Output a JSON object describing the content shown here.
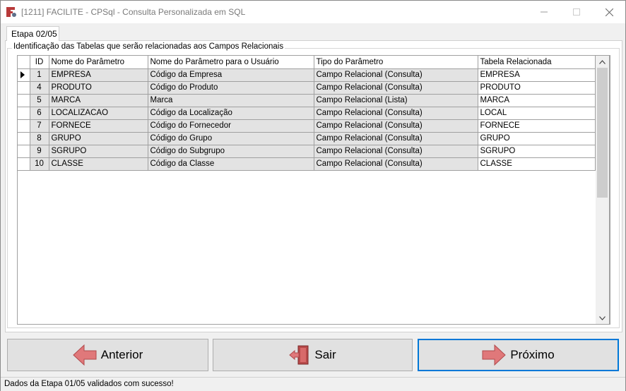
{
  "window": {
    "title": "[1211] FACILITE - CPSql - Consulta Personalizada em SQL",
    "icon": "facilite-app-icon",
    "controls": [
      "minimize",
      "maximize",
      "close"
    ]
  },
  "tab": {
    "label": "Etapa 02/05"
  },
  "group": {
    "legend": "Identificação das Tabelas que serão relacionadas aos Campos Relacionais"
  },
  "grid": {
    "columns": [
      "ID",
      "Nome do Parâmetro",
      "Nome do Parâmetro para o Usuário",
      "Tipo do Parâmetro",
      "Tabela Relacionada"
    ],
    "rows": [
      {
        "id": "1",
        "nome": "EMPRESA",
        "nome_usuario": "Código da Empresa",
        "tipo": "Campo Relacional (Consulta)",
        "tabela": "EMPRESA"
      },
      {
        "id": "4",
        "nome": "PRODUTO",
        "nome_usuario": "Código do Produto",
        "tipo": "Campo Relacional (Consulta)",
        "tabela": "PRODUTO"
      },
      {
        "id": "5",
        "nome": "MARCA",
        "nome_usuario": "Marca",
        "tipo": "Campo Relacional (Lista)",
        "tabela": "MARCA"
      },
      {
        "id": "6",
        "nome": "LOCALIZACAO",
        "nome_usuario": "Código da Localização",
        "tipo": "Campo Relacional (Consulta)",
        "tabela": "LOCAL"
      },
      {
        "id": "7",
        "nome": "FORNECE",
        "nome_usuario": "Código do Fornecedor",
        "tipo": "Campo Relacional (Consulta)",
        "tabela": "FORNECE"
      },
      {
        "id": "8",
        "nome": "GRUPO",
        "nome_usuario": "Código do Grupo",
        "tipo": "Campo Relacional (Consulta)",
        "tabela": "GRUPO"
      },
      {
        "id": "9",
        "nome": "SGRUPO",
        "nome_usuario": "Código do Subgrupo",
        "tipo": "Campo Relacional (Consulta)",
        "tabela": "SGRUPO"
      },
      {
        "id": "10",
        "nome": "CLASSE",
        "nome_usuario": "Código da Classe",
        "tipo": "Campo Relacional (Consulta)",
        "tabela": "CLASSE"
      }
    ],
    "selected_row": 0
  },
  "buttons": {
    "prev": {
      "label": "Anterior",
      "icon": "arrow-left-icon"
    },
    "exit": {
      "label": "Sair",
      "icon": "exit-door-icon"
    },
    "next": {
      "label": "Próximo",
      "icon": "arrow-right-icon"
    }
  },
  "status": {
    "text": "Dados da Etapa 01/05 validados com sucesso!"
  },
  "colors": {
    "arrow": "#e0787a",
    "primary_border": "#0078d7",
    "cell_bg": "#e3e3e3"
  }
}
